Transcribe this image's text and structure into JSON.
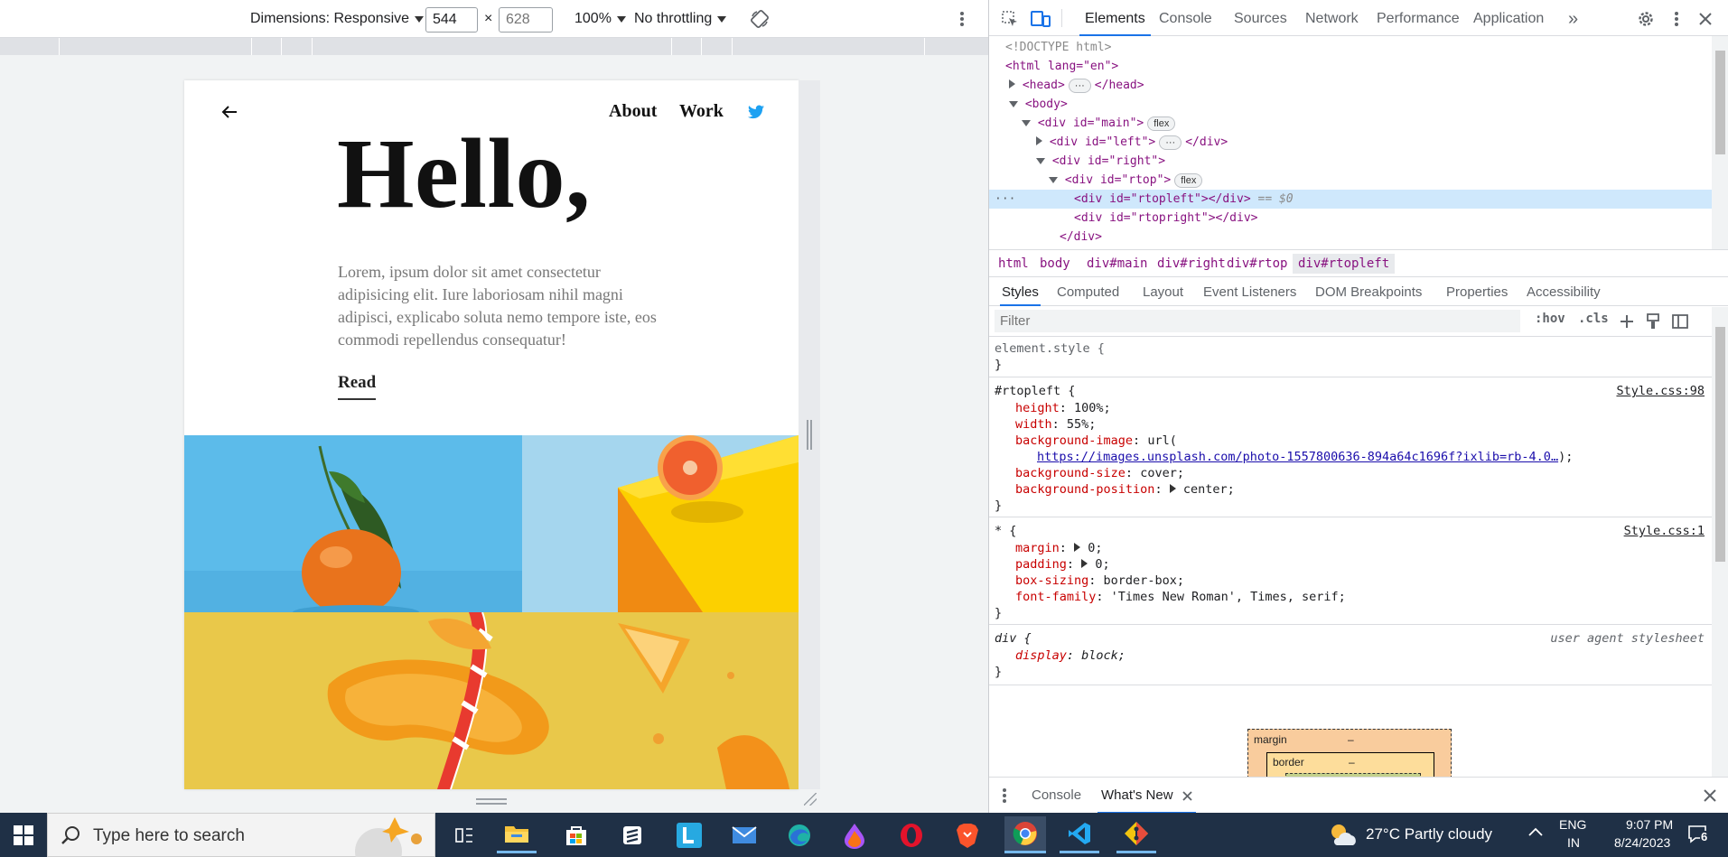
{
  "device_toolbar": {
    "dimensions_label": "Dimensions: Responsive",
    "width_value": "544",
    "height_placeholder": "628",
    "times": "×",
    "zoom": "100%",
    "throttling": "No throttling"
  },
  "page": {
    "nav_about": "About",
    "nav_work": "Work",
    "heading": "Hello,",
    "body_text": "Lorem, ipsum dolor sit amet consectetur adipisicing elit. Iure laboriosam nihil magni adipisci, explicabo soluta nemo tempore iste, eos commodi repellendus consequatur!",
    "read_link": "Read"
  },
  "devtools": {
    "tabs": [
      "Elements",
      "Console",
      "Sources",
      "Network",
      "Performance",
      "Application"
    ],
    "more_tabs": "»",
    "dom": {
      "doctype": "<!DOCTYPE html>",
      "html_open": "<html lang=\"en\">",
      "head": "<head>",
      "head_close": "</head>",
      "body": "<body>",
      "div_main": "<div id=\"main\">",
      "flex": "flex",
      "div_left": "<div id=\"left\">",
      "div_left_close": "</div>",
      "div_right": "<div id=\"right\">",
      "div_rtop": "<div id=\"rtop\">",
      "div_rtopleft": "<div id=\"rtopleft\"></div>",
      "selected_marker": "== $0",
      "div_rtopright": "<div id=\"rtopright\"></div>",
      "div_close": "</div>",
      "ellipsis": "···"
    },
    "breadcrumbs": [
      "html",
      "body",
      "div#main",
      "div#right",
      "div#rtop",
      "div#rtopleft"
    ],
    "subtabs": [
      "Styles",
      "Computed",
      "Layout",
      "Event Listeners",
      "DOM Breakpoints",
      "Properties",
      "Accessibility"
    ],
    "filter_placeholder": "Filter",
    "hov": ":hov",
    "cls": ".cls",
    "rules": {
      "element_style": "element.style {",
      "close_brace": "}",
      "rtopleft_selector": "#rtopleft {",
      "rtopleft_source": "Style.css:98",
      "height_prop": "height",
      "height_val": "100%;",
      "width_prop": "width",
      "width_val": "55%;",
      "bgimg_prop": "background-image",
      "bgimg_val": "url(",
      "bgimg_url": "https://images.unsplash.com/photo-1557800636-894a64c1696f?ixlib=rb-4.0…",
      "bgimg_end": ");",
      "bgsize_prop": "background-size",
      "bgsize_val": "cover;",
      "bgpos_prop": "background-position",
      "bgpos_val": "center;",
      "star_selector": "* {",
      "star_source": "Style.css:1",
      "margin_prop": "margin",
      "margin_val": "0;",
      "padding_prop": "padding",
      "padding_val": "0;",
      "boxsizing_prop": "box-sizing",
      "boxsizing_val": "border-box;",
      "fontfamily_prop": "font-family",
      "fontfamily_val": "'Times New Roman', Times, serif;",
      "div_selector": "div {",
      "ua_label": "user agent stylesheet",
      "display_prop": "display",
      "display_val": "block;"
    },
    "boxmodel": {
      "margin_label": "margin",
      "margin_val": "–",
      "border_label": "border",
      "border_val": "–"
    },
    "drawer_tabs": [
      "Console",
      "What's New"
    ]
  },
  "taskbar": {
    "search_placeholder": "Type here to search",
    "weather": "27°C  Partly cloudy",
    "lang_top": "ENG",
    "lang_bottom": "IN",
    "time": "9:07 PM",
    "date": "8/24/2023",
    "notifications": "6"
  },
  "colors": {
    "accent": "#1a73e8",
    "taskbar": "#1f3046",
    "twitter": "#1da1f2"
  }
}
